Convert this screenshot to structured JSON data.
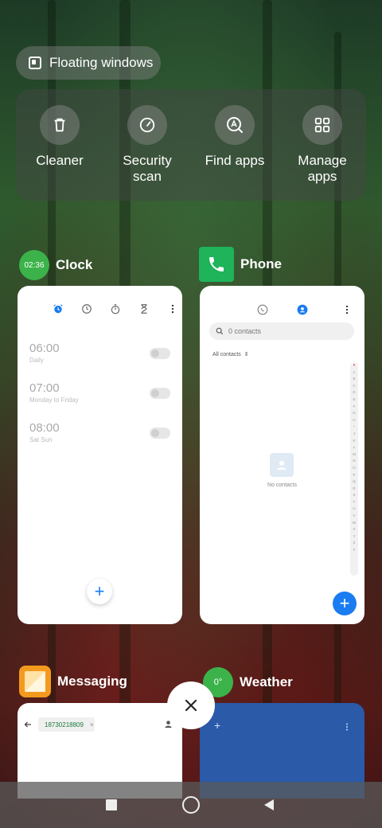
{
  "floating_windows": {
    "label": "Floating windows"
  },
  "quick_actions": [
    {
      "label": "Cleaner",
      "icon": "trash-icon"
    },
    {
      "label": "Security\nscan",
      "line1": "Security",
      "line2": "scan",
      "icon": "speed-gauge-icon"
    },
    {
      "label": "Find apps",
      "icon": "search-apps-icon"
    },
    {
      "label": "Manage apps",
      "line1": "Manage",
      "line2": "apps",
      "icon": "grid-icon"
    }
  ],
  "apps": {
    "clock": {
      "name": "Clock",
      "badge": "02:36",
      "alarms": [
        {
          "time": "06:00",
          "repeat": "Daily"
        },
        {
          "time": "07:00",
          "repeat": "Monday to Friday"
        },
        {
          "time": "08:00",
          "repeat": "Sat Sun"
        }
      ]
    },
    "phone": {
      "name": "Phone",
      "search_placeholder": "0 contacts",
      "filter": "All contacts",
      "empty_text": "No contacts",
      "alphabet": [
        "♥",
        "A",
        "B",
        "C",
        "D",
        "E",
        "F",
        "G",
        "H",
        "I",
        "J",
        "K",
        "L",
        "M",
        "N",
        "O",
        "P",
        "Q",
        "R",
        "S",
        "T",
        "U",
        "V",
        "W",
        "X",
        "Y",
        "Z",
        "#"
      ]
    },
    "messaging": {
      "name": "Messaging",
      "recipient": "18730218809"
    },
    "weather": {
      "name": "Weather",
      "badge": "0°"
    }
  },
  "colors": {
    "accent_blue": "#1a7cf0",
    "clock_green": "#3bb34a",
    "phone_green": "#1fb35a"
  }
}
